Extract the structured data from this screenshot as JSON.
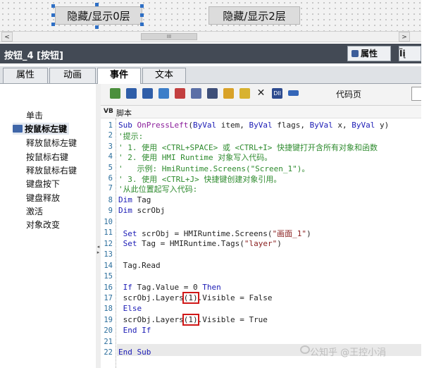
{
  "canvas": {
    "button_layer0": "隐藏/显示0层",
    "button_layer2": "隐藏/显示2层"
  },
  "hscroll": {
    "left_arrow": "<",
    "right_arrow": ">",
    "thumb_grip": "III"
  },
  "titlebar": {
    "title": "按钮_4 [按钮]",
    "tab_properties": "属性",
    "tab_info": "Ïį"
  },
  "property_tabs": [
    "属性",
    "动画",
    "事件",
    "文本"
  ],
  "events": {
    "items": [
      "单击",
      "按鼠标左键",
      "释放鼠标左键",
      "按鼠标右键",
      "释放鼠标右键",
      "键盘按下",
      "键盘释放",
      "激活",
      "对象改变"
    ],
    "selected": "按鼠标左键"
  },
  "toolbar": {
    "icons": [
      "insert-snippet-icon",
      "indent-icon",
      "outdent-icon",
      "comment-icon",
      "uncomment-icon",
      "bookmark-icon",
      "cut-icon",
      "paste-icon",
      "find-icon",
      "delete-icon",
      "dll-icon",
      "window-icon"
    ],
    "delete_glyph": "✕",
    "dll_glyph": "Dll",
    "code_page_label": "代码页"
  },
  "editor": {
    "header_vb": "VB",
    "header_label": "脚本",
    "line_numbers": [
      "1",
      "2",
      "3",
      "4",
      "5",
      "6",
      "7",
      "8",
      "9",
      "10",
      "11",
      "12",
      "13",
      "14",
      "15",
      "16",
      "17",
      "18",
      "19",
      "20",
      "21",
      "22"
    ],
    "lines": [
      "Sub OnPressLeft(ByVal item, ByVal flags, ByVal x, ByVal y)",
      "'提示:",
      "' 1. 使用 <CTRL+SPACE> 或 <CTRL+I> 快捷键打开含所有对象和函数",
      "' 2. 使用 HMI Runtime 对象写入代码。",
      "'   示例: HmiRuntime.Screens(\"Screen_1\")。",
      "' 3. 使用 <CTRL+J> 快捷键创建对象引用。",
      "'从此位置起写入代码:",
      "Dim Tag",
      "Dim scrObj",
      "",
      " Set scrObj = HMIRuntime.Screens(\"画面_1\")",
      " Set Tag = HMIRuntime.Tags(\"layer\")",
      "",
      " Tag.Read",
      "",
      " If Tag.Value = 0 Then",
      " scrObj.Layers(1).Visible = False",
      " Else",
      " scrObj.Layers(1).Visible = True",
      " End If",
      "",
      "End Sub"
    ]
  },
  "watermark": "公知乎 @王控小涓",
  "colors": {
    "titlebar": "#434a55",
    "keyword": "#1a1ab5",
    "comment": "#2e8b2e",
    "highlight_box": "#d01818"
  }
}
